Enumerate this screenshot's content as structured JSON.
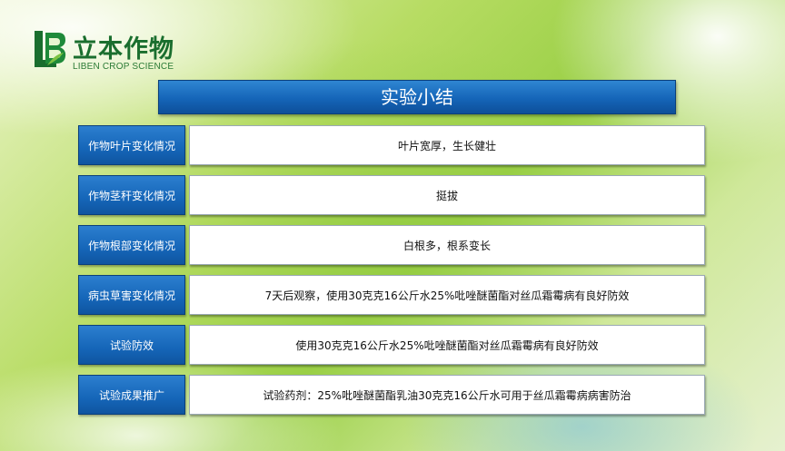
{
  "logo": {
    "cn": "立本作物",
    "en": "LIBEN CROP SCIENCE"
  },
  "title": "实验小结",
  "rows": [
    {
      "label": "作物叶片变化情况",
      "value": "叶片宽厚，生长健壮"
    },
    {
      "label": "作物茎秆变化情况",
      "value": "挺拔"
    },
    {
      "label": "作物根部变化情况",
      "value": "白根多，根系变长"
    },
    {
      "label": "病虫草害变化情况",
      "value": "7天后观察，使用30克克16公斤水25%吡唑醚菌酯对丝瓜霜霉病有良好防效"
    },
    {
      "label": "试验防效",
      "value": "使用30克克16公斤水25%吡唑醚菌酯对丝瓜霜霉病有良好防效"
    },
    {
      "label": "试验成果推广",
      "value": "试验药剂：25%吡唑醚菌酯乳油30克克16公斤水可用于丝瓜霜霉病病害防治"
    }
  ],
  "colors": {
    "accent_blue": "#1565b8",
    "logo_green": "#1a6e2e"
  }
}
